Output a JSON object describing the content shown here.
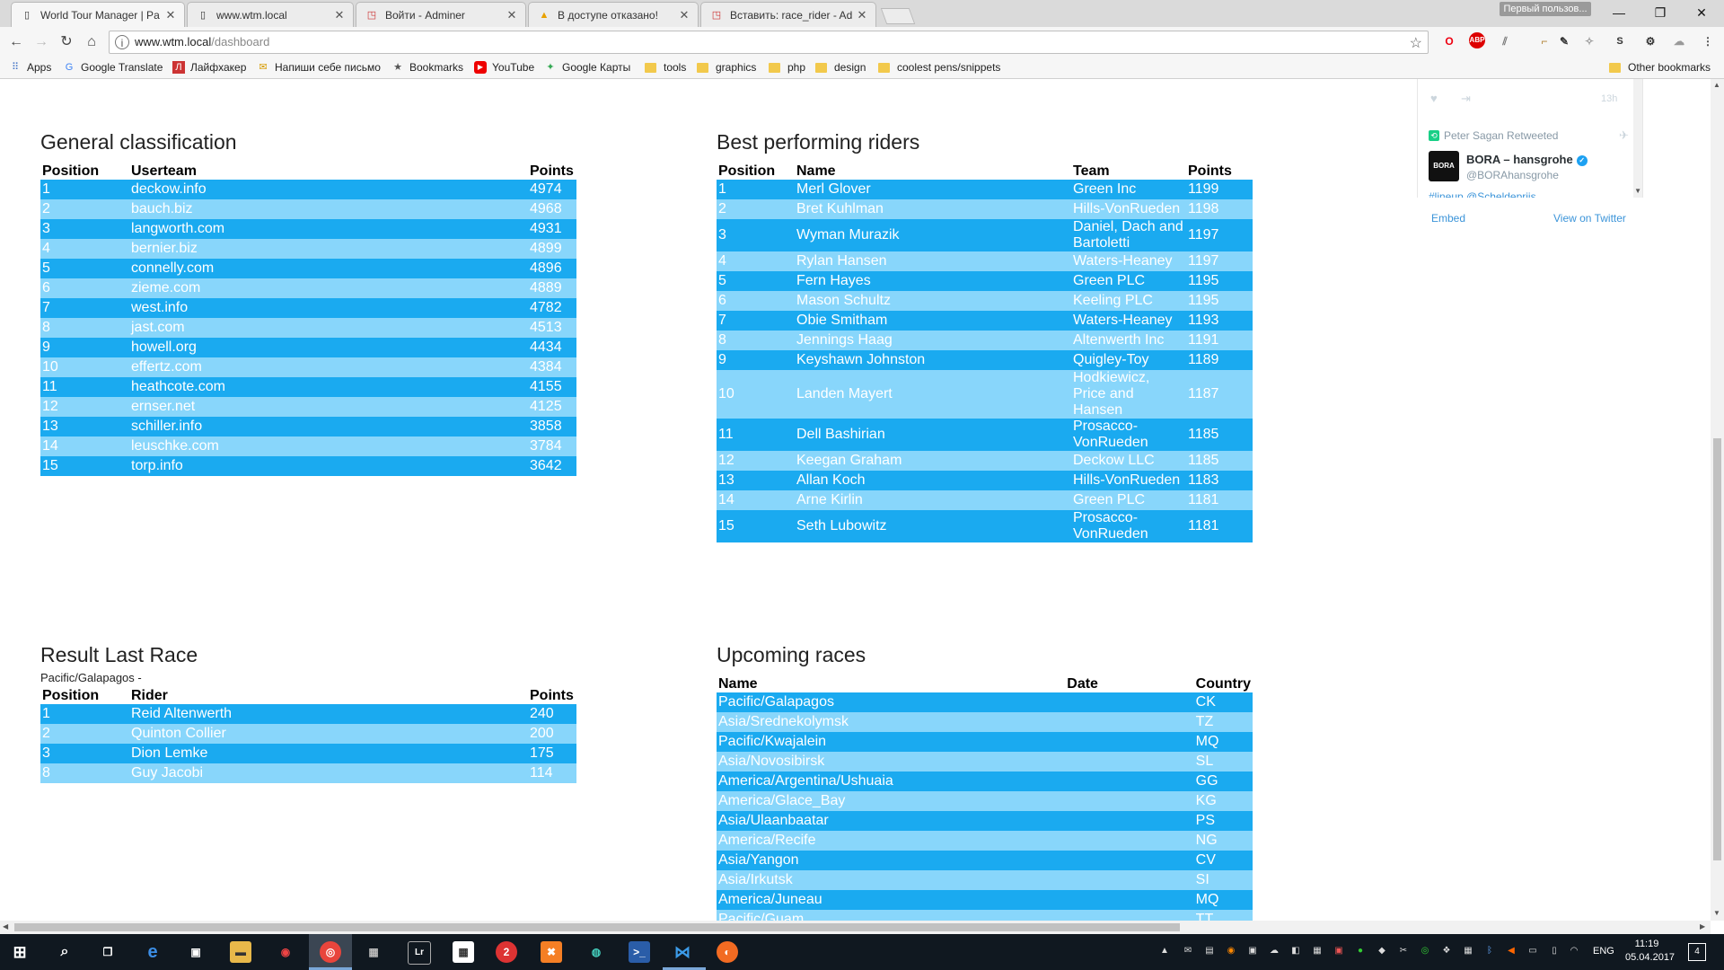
{
  "browser": {
    "tabs": [
      {
        "title": "World Tour Manager | Pa",
        "icon": "page-icon",
        "active": true
      },
      {
        "title": "www.wtm.local",
        "icon": "page-icon",
        "active": false
      },
      {
        "title": "Войти - Adminer",
        "icon": "adminer-icon",
        "active": false
      },
      {
        "title": "В доступе отказано!",
        "icon": "warning-icon",
        "active": false
      },
      {
        "title": "Вставить: race_rider - Ad",
        "icon": "adminer-icon",
        "active": false
      }
    ],
    "profile_label": "Первый пользов...",
    "url_host": "www.wtm.local",
    "url_path": "/dashboard",
    "bookmarks": [
      {
        "label": "Apps",
        "type": "apps"
      },
      {
        "label": "Google Translate",
        "type": "link"
      },
      {
        "label": "Лайфхакер",
        "type": "link"
      },
      {
        "label": "Напиши себе письмо",
        "type": "link"
      },
      {
        "label": "Bookmarks",
        "type": "link"
      },
      {
        "label": "YouTube",
        "type": "link"
      },
      {
        "label": "Google Карты",
        "type": "link"
      },
      {
        "label": "tools",
        "type": "folder"
      },
      {
        "label": "graphics",
        "type": "folder"
      },
      {
        "label": "php",
        "type": "folder"
      },
      {
        "label": "design",
        "type": "folder"
      },
      {
        "label": "coolest pens/snippets",
        "type": "folder"
      }
    ],
    "other_bookmarks": "Other bookmarks"
  },
  "general_classification": {
    "title": "General classification",
    "headers": [
      "Position",
      "Userteam",
      "Points"
    ],
    "rows": [
      [
        "1",
        "deckow.info",
        "4974"
      ],
      [
        "2",
        "bauch.biz",
        "4968"
      ],
      [
        "3",
        "langworth.com",
        "4931"
      ],
      [
        "4",
        "bernier.biz",
        "4899"
      ],
      [
        "5",
        "connelly.com",
        "4896"
      ],
      [
        "6",
        "zieme.com",
        "4889"
      ],
      [
        "7",
        "west.info",
        "4782"
      ],
      [
        "8",
        "jast.com",
        "4513"
      ],
      [
        "9",
        "howell.org",
        "4434"
      ],
      [
        "10",
        "effertz.com",
        "4384"
      ],
      [
        "11",
        "heathcote.com",
        "4155"
      ],
      [
        "12",
        "ernser.net",
        "4125"
      ],
      [
        "13",
        "schiller.info",
        "3858"
      ],
      [
        "14",
        "leuschke.com",
        "3784"
      ],
      [
        "15",
        "torp.info",
        "3642"
      ]
    ]
  },
  "best_riders": {
    "title": "Best performing riders",
    "headers": [
      "Position",
      "Name",
      "Team",
      "Points"
    ],
    "rows": [
      [
        "1",
        "Merl Glover",
        "Green Inc",
        "1199"
      ],
      [
        "2",
        "Bret Kuhlman",
        "Hills-VonRueden",
        "1198"
      ],
      [
        "3",
        "Wyman Murazik",
        "Daniel, Dach and Bartoletti",
        "1197"
      ],
      [
        "4",
        "Rylan Hansen",
        "Waters-Heaney",
        "1197"
      ],
      [
        "5",
        "Fern Hayes",
        "Green PLC",
        "1195"
      ],
      [
        "6",
        "Mason Schultz",
        "Keeling PLC",
        "1195"
      ],
      [
        "7",
        "Obie Smitham",
        "Waters-Heaney",
        "1193"
      ],
      [
        "8",
        "Jennings Haag",
        "Altenwerth Inc",
        "1191"
      ],
      [
        "9",
        "Keyshawn Johnston",
        "Quigley-Toy",
        "1189"
      ],
      [
        "10",
        "Landen Mayert",
        "Hodkiewicz, Price and Hansen",
        "1187"
      ],
      [
        "11",
        "Dell Bashirian",
        "Prosacco-VonRueden",
        "1185"
      ],
      [
        "12",
        "Keegan Graham",
        "Deckow LLC",
        "1185"
      ],
      [
        "13",
        "Allan Koch",
        "Hills-VonRueden",
        "1183"
      ],
      [
        "14",
        "Arne Kirlin",
        "Green PLC",
        "1181"
      ],
      [
        "15",
        "Seth Lubowitz",
        "Prosacco-VonRueden",
        "1181"
      ]
    ]
  },
  "last_race": {
    "title": "Result Last Race",
    "subtitle": "Pacific/Galapagos -",
    "headers": [
      "Position",
      "Rider",
      "Points"
    ],
    "rows": [
      [
        "1",
        "Reid Altenwerth",
        "240"
      ],
      [
        "2",
        "Quinton Collier",
        "200"
      ],
      [
        "3",
        "Dion Lemke",
        "175"
      ],
      [
        "8",
        "Guy Jacobi",
        "114"
      ]
    ]
  },
  "upcoming": {
    "title": "Upcoming races",
    "headers": [
      "Name",
      "Date",
      "Country"
    ],
    "rows": [
      [
        "Pacific/Galapagos",
        "",
        "CK"
      ],
      [
        "Asia/Srednekolymsk",
        "",
        "TZ"
      ],
      [
        "Pacific/Kwajalein",
        "",
        "MQ"
      ],
      [
        "Asia/Novosibirsk",
        "",
        "SL"
      ],
      [
        "America/Argentina/Ushuaia",
        "",
        "GG"
      ],
      [
        "America/Glace_Bay",
        "",
        "KG"
      ],
      [
        "Asia/Ulaanbaatar",
        "",
        "PS"
      ],
      [
        "America/Recife",
        "",
        "NG"
      ],
      [
        "Asia/Yangon",
        "",
        "CV"
      ],
      [
        "Asia/Irkutsk",
        "",
        "SI"
      ],
      [
        "America/Juneau",
        "",
        "MQ"
      ],
      [
        "Pacific/Guam",
        "",
        "TT"
      ]
    ]
  },
  "twitter": {
    "time": "13h",
    "retweet_label": "Peter Sagan Retweeted",
    "account_name": "BORA – hansgrohe",
    "account_handle": "@BORAhansgrohe",
    "avatar_text": "BORA",
    "link_text": "#lineup @Scheldeprijs",
    "embed_label": "Embed",
    "view_label": "View on Twitter"
  },
  "taskbar": {
    "language": "ENG",
    "time": "11:19",
    "date": "05.04.2017",
    "notifications": "4"
  },
  "colors": {
    "row_dark": "#1aaaf0",
    "row_light": "#88d6fb"
  }
}
